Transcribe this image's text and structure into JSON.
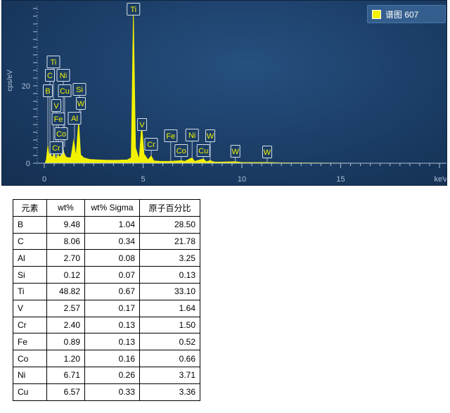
{
  "chart_data": {
    "type": "line",
    "xlabel": "keV",
    "ylabel": "cps/eV",
    "xlim": [
      0,
      20
    ],
    "ylim": [
      -0.3,
      40
    ],
    "x_ticks": [
      0,
      5,
      10,
      15
    ],
    "y_ticks": [
      0,
      20
    ],
    "series": [
      {
        "name": "谱图 607",
        "color": "#f2f200",
        "points": [
          [
            0.05,
            0.2
          ],
          [
            0.1,
            0.9
          ],
          [
            0.15,
            3.2
          ],
          [
            0.18,
            4.6
          ],
          [
            0.22,
            2.8
          ],
          [
            0.27,
            1.7
          ],
          [
            0.3,
            4.9
          ],
          [
            0.33,
            2.4
          ],
          [
            0.38,
            1.4
          ],
          [
            0.45,
            2.0
          ],
          [
            0.52,
            2.6
          ],
          [
            0.55,
            1.4
          ],
          [
            0.62,
            1.2
          ],
          [
            0.7,
            2.4
          ],
          [
            0.75,
            1.6
          ],
          [
            0.85,
            2.0
          ],
          [
            0.93,
            4.2
          ],
          [
            1.0,
            2.6
          ],
          [
            1.1,
            1.6
          ],
          [
            1.25,
            1.4
          ],
          [
            1.35,
            1.5
          ],
          [
            1.49,
            6.2
          ],
          [
            1.6,
            1.7
          ],
          [
            1.74,
            11.0
          ],
          [
            1.84,
            2.2
          ],
          [
            2.0,
            1.4
          ],
          [
            2.3,
            1.0
          ],
          [
            2.7,
            0.9
          ],
          [
            3.2,
            0.8
          ],
          [
            3.7,
            0.8
          ],
          [
            4.2,
            0.9
          ],
          [
            4.4,
            1.4
          ],
          [
            4.51,
            39.5
          ],
          [
            4.62,
            4.0
          ],
          [
            4.8,
            1.0
          ],
          [
            4.93,
            10.0
          ],
          [
            5.05,
            2.4
          ],
          [
            5.25,
            0.9
          ],
          [
            5.41,
            1.9
          ],
          [
            5.55,
            0.6
          ],
          [
            5.9,
            0.5
          ],
          [
            6.4,
            0.5
          ],
          [
            6.93,
            0.7
          ],
          [
            7.1,
            0.5
          ],
          [
            7.48,
            1.4
          ],
          [
            7.6,
            0.5
          ],
          [
            8.05,
            1.1
          ],
          [
            8.2,
            0.4
          ],
          [
            8.4,
            0.7
          ],
          [
            8.6,
            0.3
          ],
          [
            9.0,
            0.3
          ],
          [
            9.67,
            0.4
          ],
          [
            10.0,
            0.2
          ],
          [
            11.28,
            0.2
          ],
          [
            12.0,
            0.1
          ],
          [
            14.0,
            0.05
          ],
          [
            16.0,
            0.02
          ],
          [
            20.0,
            0.0
          ]
        ]
      }
    ],
    "peak_labels": [
      {
        "label": "Ti",
        "x": 4.51
      },
      {
        "label": "V",
        "x": 4.95
      },
      {
        "label": "Cr",
        "x": 5.41
      },
      {
        "label": "Fe",
        "x": 6.4
      },
      {
        "label": "Ni",
        "x": 7.48
      },
      {
        "label": "W",
        "x": 8.4
      },
      {
        "label": "Co",
        "x": 6.93
      },
      {
        "label": "Cu",
        "x": 8.05
      },
      {
        "label": "W",
        "x": 9.67
      },
      {
        "label": "W",
        "x": 11.28
      },
      {
        "label": "Ti",
        "x": 0.45
      },
      {
        "label": "C",
        "x": 0.28
      },
      {
        "label": "Ni",
        "x": 0.85
      },
      {
        "label": "B",
        "x": 0.18
      },
      {
        "label": "Cu",
        "x": 0.93
      },
      {
        "label": "Si",
        "x": 1.74
      },
      {
        "label": "W",
        "x": 1.78
      },
      {
        "label": "V",
        "x": 0.51
      },
      {
        "label": "Al",
        "x": 1.49
      },
      {
        "label": "Fe",
        "x": 0.7
      },
      {
        "label": "Co",
        "x": 0.78
      },
      {
        "label": "Cr",
        "x": 0.57
      }
    ]
  },
  "legend": {
    "label": "谱图 607",
    "color": "#f2f200"
  },
  "colors": {
    "background": "#1b3d66",
    "spectrum": "#f2f200",
    "axis": "#aebfd6"
  },
  "table": {
    "headers": [
      "元素",
      "wt%",
      "wt% Sigma",
      "原子百分比"
    ],
    "rows": [
      [
        "B",
        "9.48",
        "1.04",
        "28.50"
      ],
      [
        "C",
        "8.06",
        "0.34",
        "21.78"
      ],
      [
        "Al",
        "2.70",
        "0.08",
        "3.25"
      ],
      [
        "Si",
        "0.12",
        "0.07",
        "0.13"
      ],
      [
        "Ti",
        "48.82",
        "0.67",
        "33.10"
      ],
      [
        "V",
        "2.57",
        "0.17",
        "1.64"
      ],
      [
        "Cr",
        "2.40",
        "0.13",
        "1.50"
      ],
      [
        "Fe",
        "0.89",
        "0.13",
        "0.52"
      ],
      [
        "Co",
        "1.20",
        "0.16",
        "0.66"
      ],
      [
        "Ni",
        "6.71",
        "0.26",
        "3.71"
      ],
      [
        "Cu",
        "6.57",
        "0.33",
        "3.36"
      ]
    ]
  }
}
